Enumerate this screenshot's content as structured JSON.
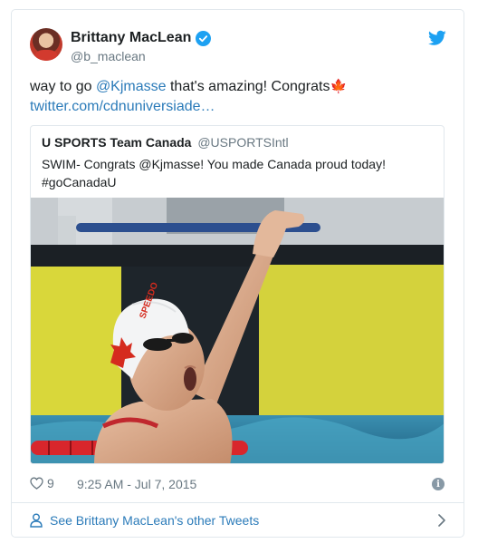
{
  "author": {
    "display_name": "Brittany MacLean",
    "handle": "@b_maclean",
    "verified": true
  },
  "tweet": {
    "text_before": "way to go ",
    "mention": "@Kjmasse",
    "text_after": " that's amazing! Congrats",
    "emoji": "🍁",
    "link": "twitter.com/cdnuniversiade…"
  },
  "quoted_tweet": {
    "display_name": "U SPORTS Team Canada",
    "handle": "@USPORTSIntl",
    "text_line1": "SWIM- Congrats @Kjmasse! You made Canada proud today!",
    "text_line2": "#goCanadaU",
    "photo_icon": "swimmer-photo"
  },
  "footer": {
    "like_count": "9",
    "timestamp": "9:25 AM - Jul 7, 2015"
  },
  "see_more": {
    "label": "See Brittany MacLean's other Tweets"
  },
  "colors": {
    "link": "#2b7bb9",
    "brand": "#1da1f2",
    "muted": "#697882",
    "border": "#e1e8ed"
  }
}
